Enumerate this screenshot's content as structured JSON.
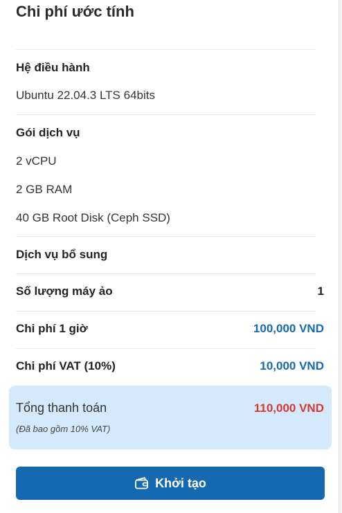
{
  "title": "Chi phí ước tính",
  "os": {
    "label": "Hệ điều hành",
    "value": "Ubuntu 22.04.3 LTS 64bits"
  },
  "package": {
    "label": "Gói dịch vụ",
    "cpu": "2 vCPU",
    "ram": "2 GB RAM",
    "disk": "40 GB Root Disk (Ceph SSD)"
  },
  "addons": {
    "label": "Dịch vụ bổ sung"
  },
  "vm_count": {
    "label": "Số lượng máy ảo",
    "value": "1"
  },
  "hourly": {
    "label": "Chi phí 1 giờ",
    "value": "100,000 VND"
  },
  "vat": {
    "label": "Chi phí VAT (10%)",
    "value": "10,000 VND"
  },
  "total": {
    "label": "Tổng thanh toán",
    "value": "110,000 VND",
    "note": "(Đã bao gồm 10% VAT)"
  },
  "create_button": {
    "label": "Khởi tạo",
    "icon": "wallet-icon"
  },
  "colors": {
    "accent": "#1569b0",
    "total": "#d43a32",
    "summary_bg": "#d4e9fb"
  }
}
